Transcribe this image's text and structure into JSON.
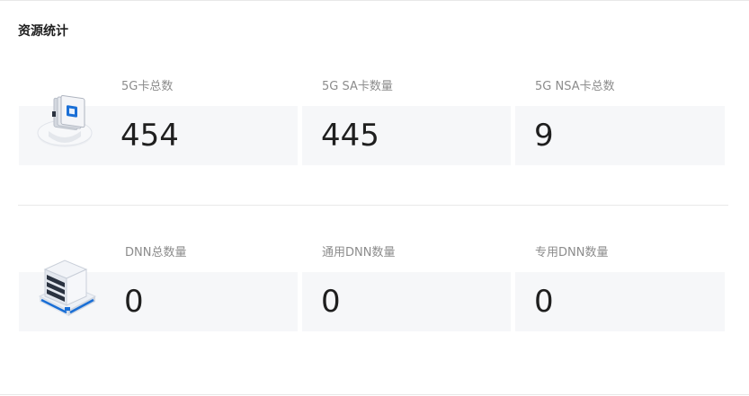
{
  "section": {
    "title": "资源统计"
  },
  "groups": [
    {
      "illustration": "sim-card-icon",
      "stats": [
        {
          "label": "5G卡总数",
          "value": "454"
        },
        {
          "label": "5G SA卡数量",
          "value": "445"
        },
        {
          "label": "5G NSA卡总数",
          "value": "9"
        }
      ]
    },
    {
      "illustration": "server-icon",
      "stats": [
        {
          "label": "DNN总数量",
          "value": "0"
        },
        {
          "label": "通用DNN数量",
          "value": "0"
        },
        {
          "label": "专用DNN数量",
          "value": "0"
        }
      ]
    }
  ],
  "colors": {
    "card_background": "#f6f7f9",
    "label": "#8c8c8c",
    "value": "#1f1f1f",
    "accent": "#1a6fd6"
  }
}
